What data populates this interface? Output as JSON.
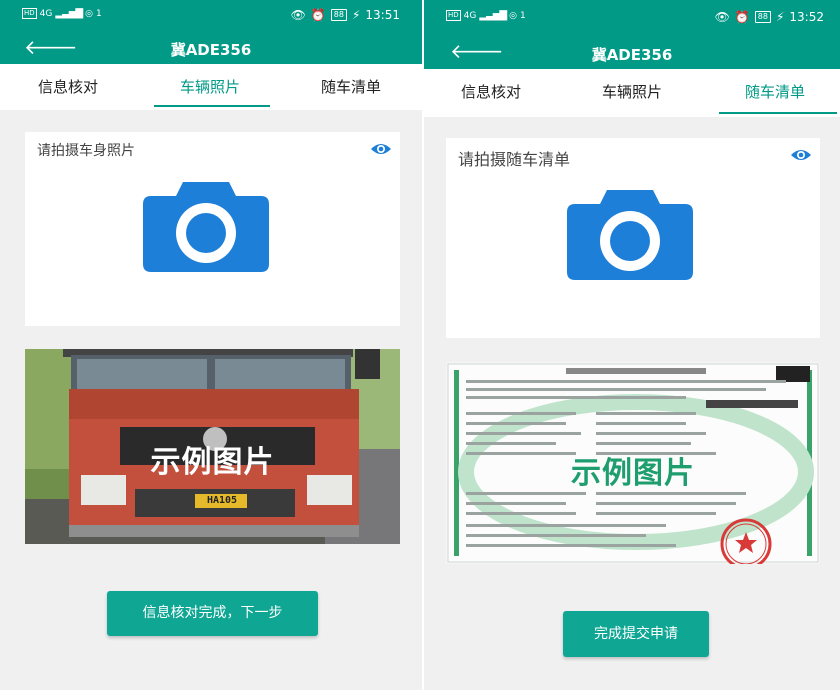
{
  "colors": {
    "accent": "#009a86",
    "button": "#0fa693",
    "camera": "#1e7fd8",
    "background": "#f0f0f0"
  },
  "screen1": {
    "status": {
      "hd": "HD",
      "net": "4G",
      "sim": "1",
      "batt": "88",
      "time": "13:51"
    },
    "title": "冀ADE356",
    "tabs": [
      {
        "label": "信息核对"
      },
      {
        "label": "车辆照片"
      },
      {
        "label": "随车清单"
      }
    ],
    "active_tab": 1,
    "photo_label": "请拍摄车身照片",
    "sample_label": "示例图片",
    "plate": "HA105",
    "button_label": "信息核对完成，下一步"
  },
  "screen2": {
    "status": {
      "hd": "HD",
      "net": "4G",
      "sim": "1",
      "batt": "88",
      "time": "13:52"
    },
    "title": "冀ADE356",
    "tabs": [
      {
        "label": "信息核对"
      },
      {
        "label": "车辆照片"
      },
      {
        "label": "随车清单"
      }
    ],
    "active_tab": 2,
    "photo_label": "请拍摄随车清单",
    "sample_label": "示例图片",
    "button_label": "完成提交申请"
  }
}
